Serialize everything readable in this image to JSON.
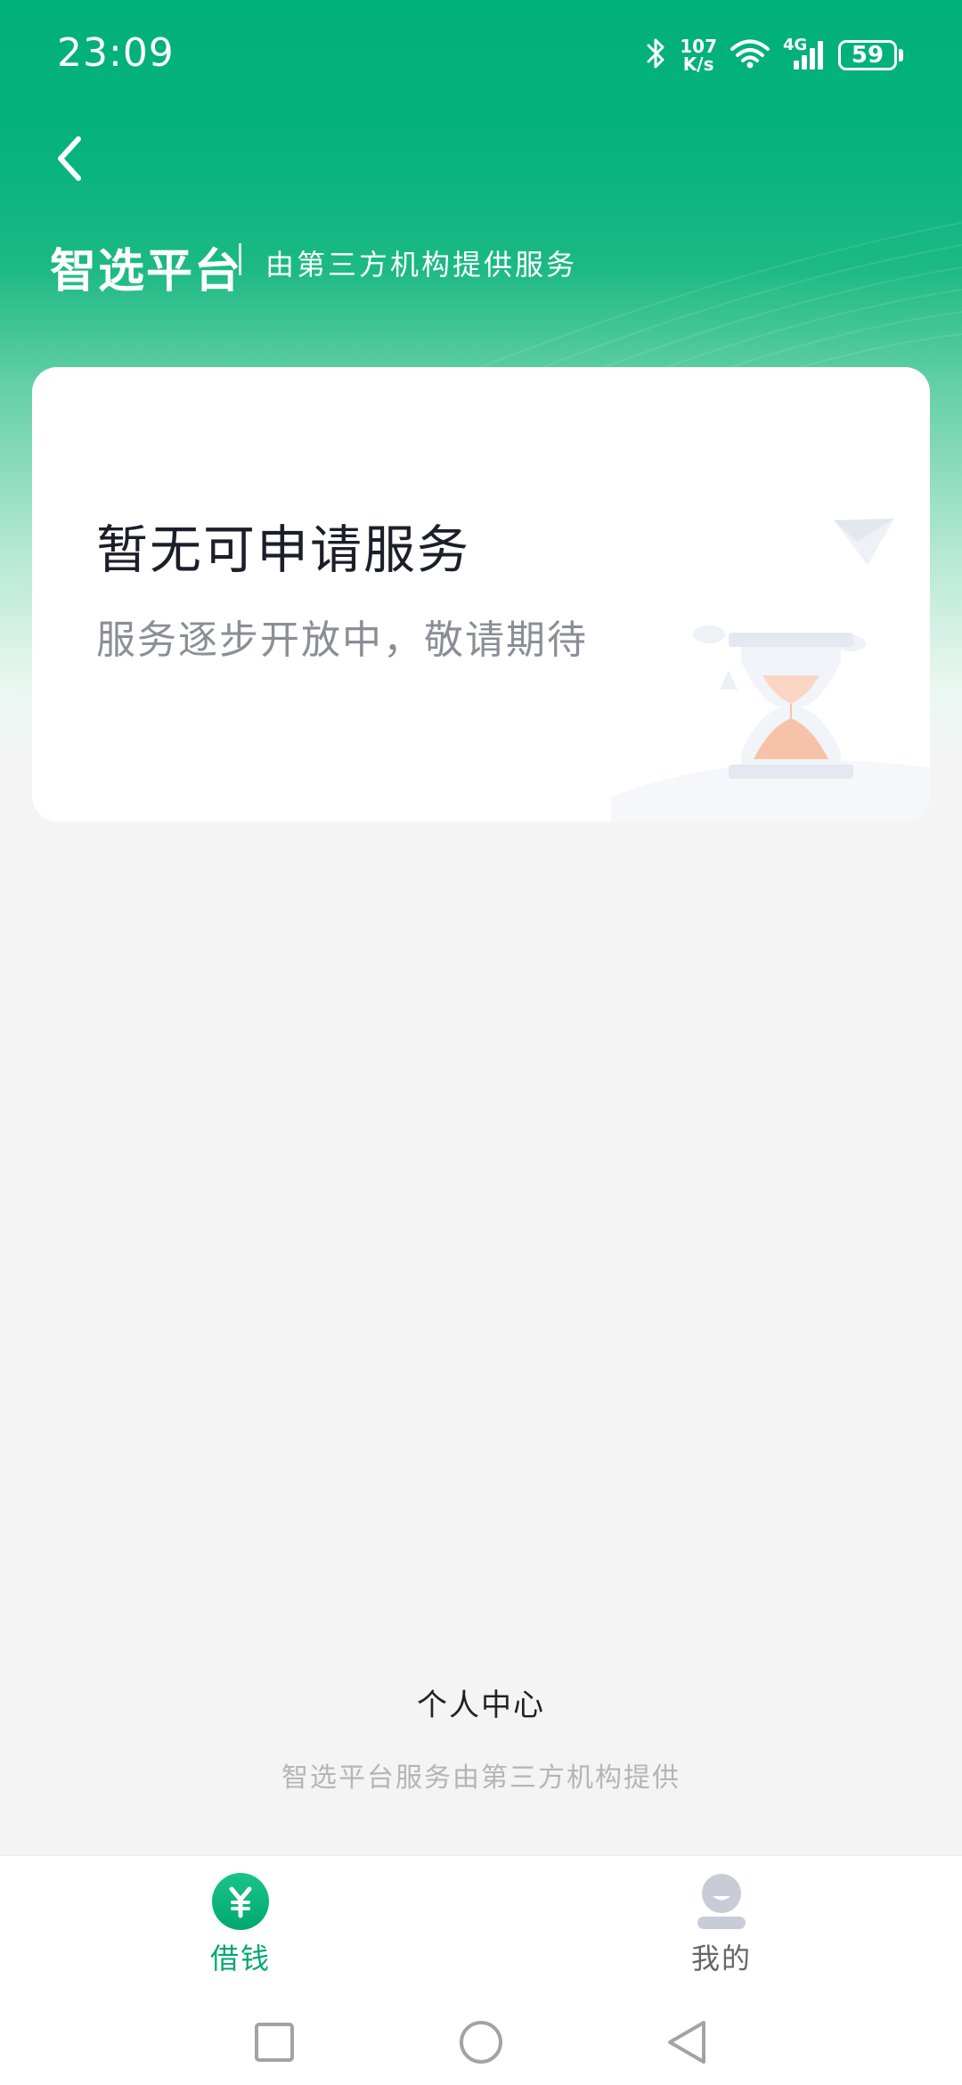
{
  "status_bar": {
    "time": "23:09",
    "net_speed_value": "107",
    "net_speed_unit": "K/s",
    "network_type": "4G",
    "battery_level": "59",
    "icons": [
      "bluetooth-icon",
      "wifi-icon",
      "signal-icon",
      "battery-icon"
    ]
  },
  "header": {
    "back_icon": "chevron-left-icon",
    "title": "智选平台",
    "subtitle": "由第三方机构提供服务"
  },
  "card": {
    "title": "暂无可申请服务",
    "description": "服务逐步开放中，敬请期待",
    "illustration": "hourglass-illustration"
  },
  "footer": {
    "personal_center": "个人中心",
    "note": "智选平台服务由第三方机构提供"
  },
  "tab_bar": {
    "tabs": [
      {
        "label": "借钱",
        "icon": "yuan-icon",
        "active": true
      },
      {
        "label": "我的",
        "icon": "user-icon",
        "active": false
      }
    ],
    "yuan_symbol": "¥"
  },
  "nav_bar": {
    "buttons": [
      "recent-apps-icon",
      "home-icon",
      "back-triangle-icon"
    ]
  },
  "colors": {
    "brand_green": "#00b079",
    "active_tab": "#00a870",
    "background": "#f4f4f4"
  }
}
